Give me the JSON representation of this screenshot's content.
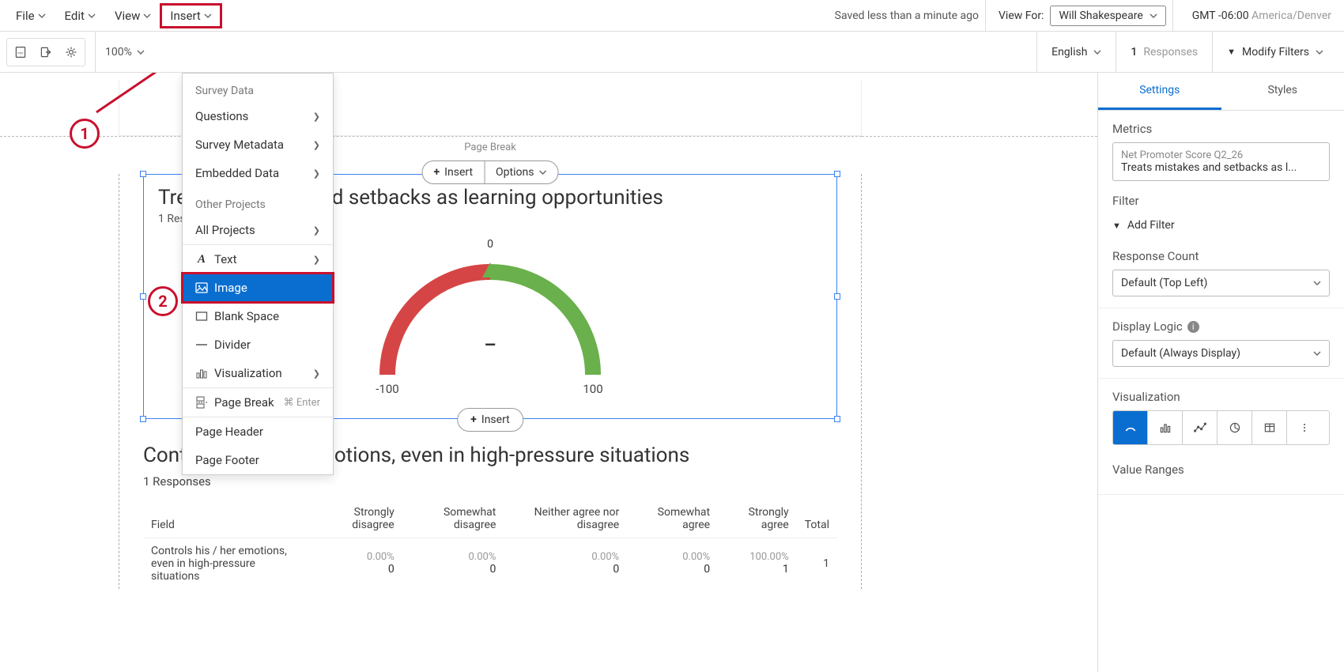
{
  "menubar": {
    "file": "File",
    "edit": "Edit",
    "view": "View",
    "insert": "Insert"
  },
  "header": {
    "save_status": "Saved less than a minute ago",
    "view_for_label": "View For:",
    "view_for_value": "Will Shakespeare",
    "timezone_offset": "GMT -06:00",
    "timezone_region": "America/Denver"
  },
  "toolbar": {
    "zoom": "100%",
    "language": "English",
    "responses_count": "1",
    "responses_label": "Responses",
    "modify_filters": "Modify Filters"
  },
  "dropdown": {
    "section_survey": "Survey Data",
    "questions": "Questions",
    "survey_metadata": "Survey Metadata",
    "embedded_data": "Embedded Data",
    "section_other": "Other Projects",
    "all_projects": "All Projects",
    "text": "Text",
    "image": "Image",
    "blank_space": "Blank Space",
    "divider": "Divider",
    "visualization": "Visualization",
    "page_break": "Page Break",
    "page_break_shortcut": "⌘ Enter",
    "page_header": "Page Header",
    "page_footer": "Page Footer"
  },
  "annotations": {
    "step1": "1",
    "step2": "2"
  },
  "page": {
    "page_break_label": "Page Break",
    "viz_toolbar_insert": "Insert",
    "viz_toolbar_options": "Options",
    "insert_pill": "Insert"
  },
  "viz1": {
    "title": "Treats mistakes and setbacks as learning opportunities",
    "subtitle": "1 Responses"
  },
  "chart_data": {
    "type": "gauge",
    "value": null,
    "display_value": "–",
    "top_label": "0",
    "range_min": -100,
    "range_max": 100,
    "needle_position": 0,
    "segments": [
      {
        "from": -100,
        "to": 0,
        "color": "#d64545"
      },
      {
        "from": 0,
        "to": 100,
        "color": "#6ab04c"
      }
    ]
  },
  "viz2": {
    "title": "Controls his / her emotions, even in high-pressure situations",
    "subtitle": "1 Responses"
  },
  "table": {
    "headers": [
      "Field",
      "Strongly disagree",
      "Somewhat disagree",
      "Neither agree nor disagree",
      "Somewhat agree",
      "Strongly agree",
      "Total"
    ],
    "rows": [
      {
        "field": "Controls his / her emotions, even in high-pressure situations",
        "cells": [
          {
            "pct": "0.00%",
            "count": "0"
          },
          {
            "pct": "0.00%",
            "count": "0"
          },
          {
            "pct": "0.00%",
            "count": "0"
          },
          {
            "pct": "0.00%",
            "count": "0"
          },
          {
            "pct": "100.00%",
            "count": "1"
          }
        ],
        "total": "1"
      }
    ]
  },
  "sidebar": {
    "tab_settings": "Settings",
    "tab_styles": "Styles",
    "metrics_label": "Metrics",
    "metric_sub": "Net Promoter Score Q2_26",
    "metric_main": "Treats mistakes and setbacks as l...",
    "filter_label": "Filter",
    "add_filter": "Add Filter",
    "response_count_label": "Response Count",
    "response_count_value": "Default (Top Left)",
    "display_logic_label": "Display Logic",
    "display_logic_value": "Default (Always Display)",
    "visualization_label": "Visualization",
    "value_ranges_label": "Value Ranges"
  }
}
